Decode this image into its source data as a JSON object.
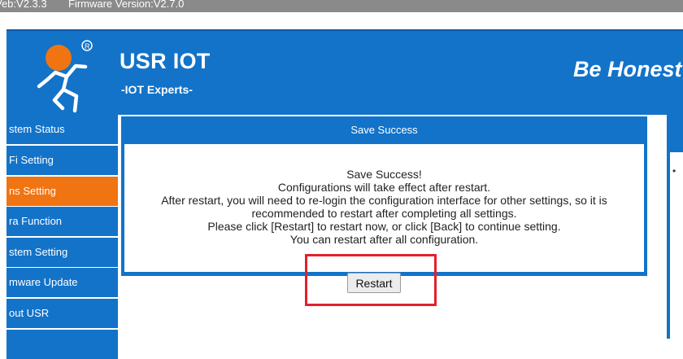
{
  "topbar": {
    "web_version": "Veb:V2.3.3",
    "firmware_version": "Firmware Version:V2.7.0"
  },
  "header": {
    "brand": "USR IOT",
    "tagline": "-IOT Experts-",
    "slogan": "Be Honest",
    "logo_icon": "running-man-logo-icon"
  },
  "sidebar": {
    "items": [
      {
        "label": "stem Status",
        "active": false
      },
      {
        "label": "Fi Setting",
        "active": false
      },
      {
        "label": "ns Setting",
        "active": true
      },
      {
        "label": "ra Function",
        "active": false
      },
      {
        "label": "stem Setting",
        "active": false
      },
      {
        "label": "mware Update",
        "active": false
      },
      {
        "label": "out USR",
        "active": false
      }
    ]
  },
  "dialog": {
    "title": "Save Success",
    "lines": [
      "Save Success!",
      "Configurations will take effect after restart.",
      "After restart, you will need to re-login the configuration interface for other settings, so it is",
      "recommended to restart after completing all settings.",
      "Please click [Restart] to restart now, or click [Back] to continue setting.",
      "You can restart after all configuration."
    ],
    "restart_label": "Restart"
  },
  "right_panel": {
    "bullet": "•"
  },
  "colors": {
    "primary": "#1273c9",
    "active": "#f07411",
    "highlight": "#e3202a",
    "logo_orange": "#f07411"
  }
}
